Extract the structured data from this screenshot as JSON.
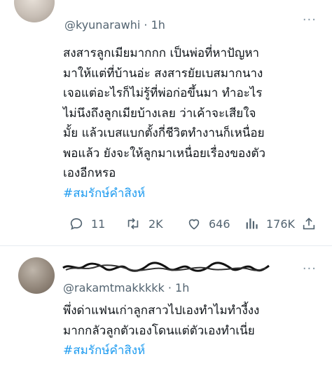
{
  "tweet1": {
    "handle": "@kyunarawhi",
    "time_sep": "·",
    "time": "1h",
    "lines": [
      "สงสารลูกเมียมากกก เป็นพ่อที่หาปัญหา",
      "มาให้แต่ที่บ้านอ่ะ สงสารยัยเบสมากนาง",
      "เจอแต่อะไรก็ไม่รู้ที่พ่อก่อขึ้นมา ทำอะไร",
      "ไม่นึงถึงลูกเมียบ้างเลย ว่าเค้าจะเสียใจ",
      "มั้ย แล้วเบสแบกตั้งกี่ชีวิตทำงานก็เหนื่อย",
      "พอแล้ว ยังจะให้ลูกมาเหนื่อยเรื่องของตัว",
      "เองอีกหรอ"
    ],
    "hashtag": "#สมรักษ์คำสิงห์",
    "replies": "11",
    "retweets": "2K",
    "likes": "646",
    "views": "176K"
  },
  "tweet2": {
    "handle": "@rakamtmakkkkk",
    "time_sep": "·",
    "time": "1h",
    "lines": [
      "พึ่งด่าแฟนเก่าลูกสาวไปเองทำไมทำงี้งง",
      "มากกลัวลูกตัวเองโดนแต่ตัวเองทำเนี่ย"
    ],
    "hashtag": "#สมรักษ์คำสิงห์"
  },
  "icons": [
    "more-icon",
    "reply-icon",
    "retweet-icon",
    "like-icon",
    "views-icon",
    "share-icon"
  ],
  "colors": {
    "hashtag": "#1d9bf0",
    "muted": "#536471"
  }
}
